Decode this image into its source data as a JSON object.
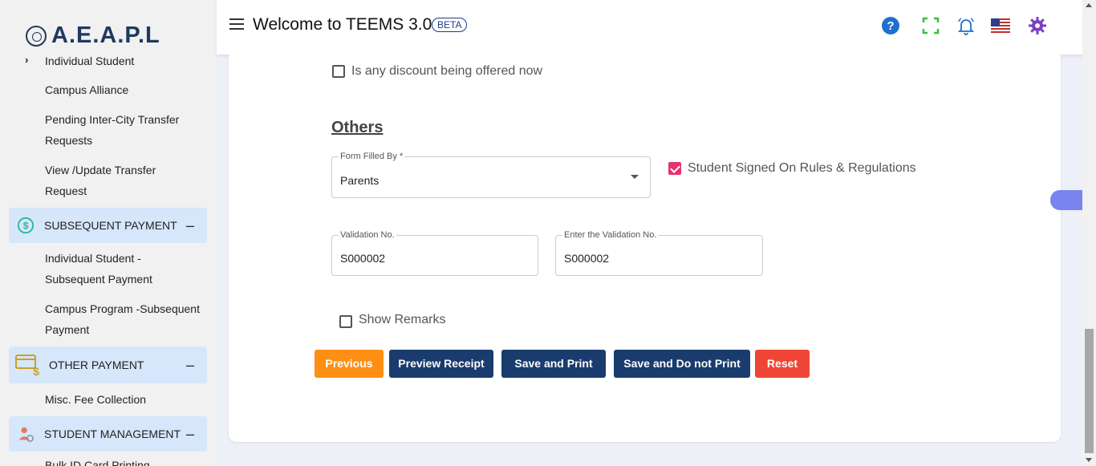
{
  "logo": {
    "text": "A.E.A.P.L"
  },
  "sidebar": {
    "items": [
      {
        "label": "Individual Student"
      },
      {
        "label": "Campus Alliance"
      },
      {
        "label": "Pending Inter-City Transfer Requests"
      },
      {
        "label": "View /Update Transfer Request"
      },
      {
        "label": "Individual Student - Subsequent Payment"
      },
      {
        "label": "Campus Program -Subsequent Payment"
      },
      {
        "label": "Misc. Fee Collection"
      },
      {
        "label": "Bulk ID Card Printing"
      }
    ],
    "sections": [
      {
        "label": "SUBSEQUENT PAYMENT",
        "toggle": "–",
        "icon": "dollar-circle-icon"
      },
      {
        "label": "OTHER PAYMENT",
        "toggle": "–",
        "icon": "card-payment-icon"
      },
      {
        "label": "STUDENT MANAGEMENT",
        "toggle": "–",
        "icon": "student-settings-icon"
      }
    ]
  },
  "header": {
    "title": "Welcome to TEEMS 3.0",
    "badge": "BETA",
    "icons": [
      "help-icon",
      "fullscreen-icon",
      "notification-bell-icon",
      "us-flag-icon",
      "settings-gear-icon"
    ]
  },
  "form": {
    "discount_label": "Is any discount being offered now",
    "discount_checked": false,
    "others_title": "Others",
    "form_filled_by": {
      "label": "Form Filled By *",
      "value": "Parents"
    },
    "student_signed": {
      "label": "Student Signed On Rules & Regulations",
      "checked": true
    },
    "validation_no": {
      "label": "Validation No.",
      "value": "S000002"
    },
    "enter_validation_no": {
      "label": "Enter the Validation No.",
      "value": "S000002"
    },
    "show_remarks": {
      "label": "Show Remarks",
      "checked": false
    }
  },
  "buttons": {
    "previous": "Previous",
    "preview_receipt": "Preview Receipt",
    "save_and_print": "Save and Print",
    "save_no_print": "Save and Do not Print",
    "reset": "Reset"
  },
  "colors": {
    "accent_navy": "#1a3b6e",
    "orange": "#fd8f14",
    "red": "#ef4536",
    "checkbox_pink": "#e8336d",
    "section_bg": "#d6e6fb"
  }
}
